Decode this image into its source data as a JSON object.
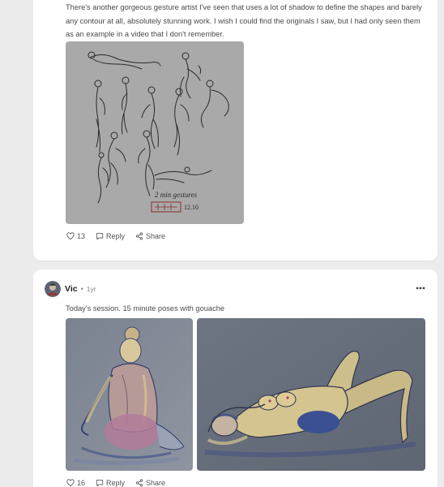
{
  "post1": {
    "text": "There's another gorgeous gesture artist I've seen that uses a lot of shadow to define the shapes and barely any contour at all, absolutely stunning work. I wish I could find the originals I saw, but I had only seen them as an example in a video that I don't remember.",
    "sketch_caption": "2 min gestures",
    "sketch_date": "12.10",
    "likes": "13",
    "reply_label": "Reply",
    "share_label": "Share"
  },
  "post2": {
    "author": "Vic",
    "separator": "•",
    "time": "1yr",
    "text": "Today's session. 15 minute poses with gouache",
    "likes": "16",
    "reply_label": "Reply",
    "share_label": "Share"
  },
  "icons": {
    "like": "heart-icon",
    "reply": "speech-bubble-icon",
    "share": "share-icon",
    "more": "more-horizontal-icon"
  },
  "colors": {
    "page_background": "#ececec",
    "card_background": "#ffffff",
    "sketch_paper": "#a9a9a9",
    "painting_paper": "#6f7784"
  }
}
